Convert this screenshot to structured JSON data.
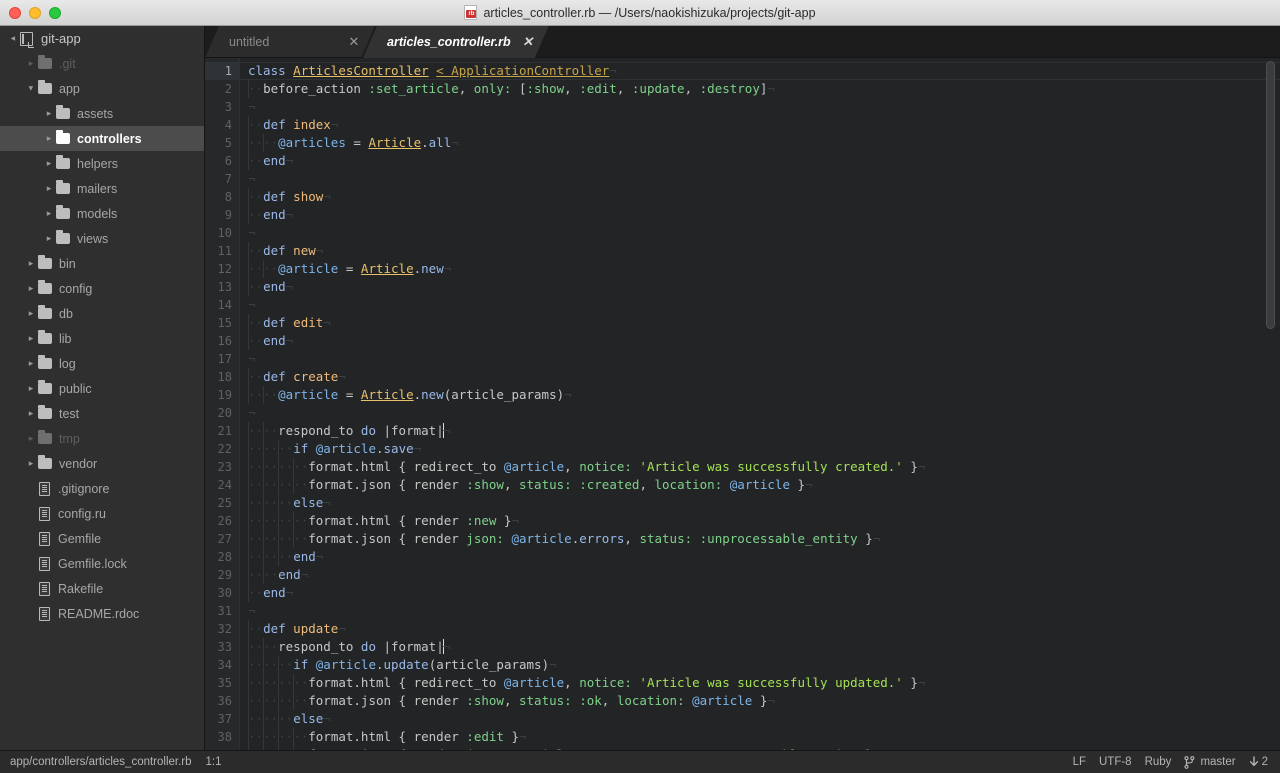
{
  "window": {
    "title": "articles_controller.rb — /Users/naokishizuka/projects/git-app",
    "file_icon": "ruby-file-icon",
    "icon_text": "rb",
    "traffic_lights": [
      "close-button",
      "minimize-button",
      "maximize-button"
    ]
  },
  "sidebar": {
    "root": {
      "label": "git-app",
      "icon": "repository-icon",
      "twisty": "▾"
    },
    "items": [
      {
        "label": ".git",
        "type": "folder",
        "depth": 1,
        "twisty": "▸",
        "dim": true,
        "selected": false
      },
      {
        "label": "app",
        "type": "folder",
        "depth": 1,
        "twisty": "▾",
        "dim": false,
        "selected": false
      },
      {
        "label": "assets",
        "type": "folder",
        "depth": 2,
        "twisty": "▸",
        "dim": false,
        "selected": false
      },
      {
        "label": "controllers",
        "type": "folder",
        "depth": 2,
        "twisty": "▸",
        "dim": false,
        "selected": true
      },
      {
        "label": "helpers",
        "type": "folder",
        "depth": 2,
        "twisty": "▸",
        "dim": false,
        "selected": false
      },
      {
        "label": "mailers",
        "type": "folder",
        "depth": 2,
        "twisty": "▸",
        "dim": false,
        "selected": false
      },
      {
        "label": "models",
        "type": "folder",
        "depth": 2,
        "twisty": "▸",
        "dim": false,
        "selected": false
      },
      {
        "label": "views",
        "type": "folder",
        "depth": 2,
        "twisty": "▸",
        "dim": false,
        "selected": false
      },
      {
        "label": "bin",
        "type": "folder",
        "depth": 1,
        "twisty": "▸",
        "dim": false,
        "selected": false
      },
      {
        "label": "config",
        "type": "folder",
        "depth": 1,
        "twisty": "▸",
        "dim": false,
        "selected": false
      },
      {
        "label": "db",
        "type": "folder",
        "depth": 1,
        "twisty": "▸",
        "dim": false,
        "selected": false
      },
      {
        "label": "lib",
        "type": "folder",
        "depth": 1,
        "twisty": "▸",
        "dim": false,
        "selected": false
      },
      {
        "label": "log",
        "type": "folder",
        "depth": 1,
        "twisty": "▸",
        "dim": false,
        "selected": false
      },
      {
        "label": "public",
        "type": "folder",
        "depth": 1,
        "twisty": "▸",
        "dim": false,
        "selected": false
      },
      {
        "label": "test",
        "type": "folder",
        "depth": 1,
        "twisty": "▸",
        "dim": false,
        "selected": false
      },
      {
        "label": "tmp",
        "type": "folder",
        "depth": 1,
        "twisty": "▸",
        "dim": true,
        "selected": false
      },
      {
        "label": "vendor",
        "type": "folder",
        "depth": 1,
        "twisty": "▸",
        "dim": false,
        "selected": false
      },
      {
        "label": ".gitignore",
        "type": "file",
        "depth": 1,
        "twisty": "",
        "dim": false,
        "selected": false
      },
      {
        "label": "config.ru",
        "type": "file",
        "depth": 1,
        "twisty": "",
        "dim": false,
        "selected": false
      },
      {
        "label": "Gemfile",
        "type": "file",
        "depth": 1,
        "twisty": "",
        "dim": false,
        "selected": false
      },
      {
        "label": "Gemfile.lock",
        "type": "file",
        "depth": 1,
        "twisty": "",
        "dim": false,
        "selected": false
      },
      {
        "label": "Rakefile",
        "type": "file",
        "depth": 1,
        "twisty": "",
        "dim": false,
        "selected": false
      },
      {
        "label": "README.rdoc",
        "type": "file",
        "depth": 1,
        "twisty": "",
        "dim": false,
        "selected": false
      }
    ]
  },
  "tabs": [
    {
      "label": "untitled",
      "active": false,
      "close_icon": "close-icon"
    },
    {
      "label": "articles_controller.rb",
      "active": true,
      "close_icon": "close-icon"
    }
  ],
  "editor": {
    "first_line": 1,
    "visible_lines": 39,
    "cursor_line": 1,
    "lines": [
      {
        "n": 1,
        "indent": 0,
        "tokens": [
          [
            "k",
            "class"
          ],
          [
            "pl",
            " "
          ],
          [
            "cls",
            "ArticlesController"
          ],
          [
            "pl",
            " "
          ],
          [
            "cls2",
            "< ApplicationController"
          ],
          [
            "inv",
            "¬"
          ]
        ]
      },
      {
        "n": 2,
        "indent": 1,
        "tokens": [
          [
            "pl",
            "before_action "
          ],
          [
            "sym",
            ":set_article"
          ],
          [
            "punc",
            ", "
          ],
          [
            "sym",
            "only:"
          ],
          [
            "punc",
            " ["
          ],
          [
            "sym",
            ":show"
          ],
          [
            "punc",
            ", "
          ],
          [
            "sym",
            ":edit"
          ],
          [
            "punc",
            ", "
          ],
          [
            "sym",
            ":update"
          ],
          [
            "punc",
            ", "
          ],
          [
            "sym",
            ":destroy"
          ],
          [
            "punc",
            "]"
          ],
          [
            "inv",
            "¬"
          ]
        ]
      },
      {
        "n": 3,
        "indent": 0,
        "tokens": [
          [
            "inv",
            "¬"
          ]
        ]
      },
      {
        "n": 4,
        "indent": 1,
        "tokens": [
          [
            "k",
            "def"
          ],
          [
            "pl",
            " "
          ],
          [
            "fn",
            "index"
          ],
          [
            "inv",
            "¬"
          ]
        ]
      },
      {
        "n": 5,
        "indent": 2,
        "tokens": [
          [
            "ivar",
            "@articles"
          ],
          [
            "pl",
            " = "
          ],
          [
            "cls",
            "Article"
          ],
          [
            "punc",
            "."
          ],
          [
            "mth",
            "all"
          ],
          [
            "inv",
            "¬"
          ]
        ]
      },
      {
        "n": 6,
        "indent": 1,
        "tokens": [
          [
            "k",
            "end"
          ],
          [
            "inv",
            "¬"
          ]
        ]
      },
      {
        "n": 7,
        "indent": 0,
        "tokens": [
          [
            "inv",
            "¬"
          ]
        ]
      },
      {
        "n": 8,
        "indent": 1,
        "tokens": [
          [
            "k",
            "def"
          ],
          [
            "pl",
            " "
          ],
          [
            "fn",
            "show"
          ],
          [
            "inv",
            "¬"
          ]
        ]
      },
      {
        "n": 9,
        "indent": 1,
        "tokens": [
          [
            "k",
            "end"
          ],
          [
            "inv",
            "¬"
          ]
        ]
      },
      {
        "n": 10,
        "indent": 0,
        "tokens": [
          [
            "inv",
            "¬"
          ]
        ]
      },
      {
        "n": 11,
        "indent": 1,
        "tokens": [
          [
            "k",
            "def"
          ],
          [
            "pl",
            " "
          ],
          [
            "fn",
            "new"
          ],
          [
            "inv",
            "¬"
          ]
        ]
      },
      {
        "n": 12,
        "indent": 2,
        "tokens": [
          [
            "ivar",
            "@article"
          ],
          [
            "pl",
            " = "
          ],
          [
            "cls",
            "Article"
          ],
          [
            "punc",
            "."
          ],
          [
            "mth",
            "new"
          ],
          [
            "inv",
            "¬"
          ]
        ]
      },
      {
        "n": 13,
        "indent": 1,
        "tokens": [
          [
            "k",
            "end"
          ],
          [
            "inv",
            "¬"
          ]
        ]
      },
      {
        "n": 14,
        "indent": 0,
        "tokens": [
          [
            "inv",
            "¬"
          ]
        ]
      },
      {
        "n": 15,
        "indent": 1,
        "tokens": [
          [
            "k",
            "def"
          ],
          [
            "pl",
            " "
          ],
          [
            "fn",
            "edit"
          ],
          [
            "inv",
            "¬"
          ]
        ]
      },
      {
        "n": 16,
        "indent": 1,
        "tokens": [
          [
            "k",
            "end"
          ],
          [
            "inv",
            "¬"
          ]
        ]
      },
      {
        "n": 17,
        "indent": 0,
        "tokens": [
          [
            "inv",
            "¬"
          ]
        ]
      },
      {
        "n": 18,
        "indent": 1,
        "tokens": [
          [
            "k",
            "def"
          ],
          [
            "pl",
            " "
          ],
          [
            "fn",
            "create"
          ],
          [
            "inv",
            "¬"
          ]
        ]
      },
      {
        "n": 19,
        "indent": 2,
        "tokens": [
          [
            "ivar",
            "@article"
          ],
          [
            "pl",
            " = "
          ],
          [
            "cls",
            "Article"
          ],
          [
            "punc",
            "."
          ],
          [
            "mth",
            "new"
          ],
          [
            "punc",
            "(article_params)"
          ],
          [
            "inv",
            "¬"
          ]
        ]
      },
      {
        "n": 20,
        "indent": 0,
        "tokens": [
          [
            "inv",
            "¬"
          ]
        ]
      },
      {
        "n": 21,
        "indent": 2,
        "tokens": [
          [
            "pl",
            "respond_to "
          ],
          [
            "k",
            "do"
          ],
          [
            "pl",
            " |format|"
          ],
          [
            "cursor",
            ""
          ],
          [
            "inv",
            "¬"
          ]
        ]
      },
      {
        "n": 22,
        "indent": 3,
        "tokens": [
          [
            "k",
            "if"
          ],
          [
            "pl",
            " "
          ],
          [
            "ivar",
            "@article"
          ],
          [
            "punc",
            "."
          ],
          [
            "mth",
            "save"
          ],
          [
            "inv",
            "¬"
          ]
        ]
      },
      {
        "n": 23,
        "indent": 4,
        "tokens": [
          [
            "pl",
            "format.html { redirect_to "
          ],
          [
            "ivar",
            "@article"
          ],
          [
            "punc",
            ", "
          ],
          [
            "sym",
            "notice:"
          ],
          [
            "pl",
            " "
          ],
          [
            "str",
            "'Article was successfully created.'"
          ],
          [
            "pl",
            " }"
          ],
          [
            "inv",
            "¬"
          ]
        ]
      },
      {
        "n": 24,
        "indent": 4,
        "tokens": [
          [
            "pl",
            "format.json { render "
          ],
          [
            "sym",
            ":show"
          ],
          [
            "punc",
            ", "
          ],
          [
            "sym",
            "status:"
          ],
          [
            "pl",
            " "
          ],
          [
            "sym",
            ":created"
          ],
          [
            "punc",
            ", "
          ],
          [
            "sym",
            "location:"
          ],
          [
            "pl",
            " "
          ],
          [
            "ivar",
            "@article"
          ],
          [
            "pl",
            " }"
          ],
          [
            "inv",
            "¬"
          ]
        ]
      },
      {
        "n": 25,
        "indent": 3,
        "tokens": [
          [
            "k",
            "else"
          ],
          [
            "inv",
            "¬"
          ]
        ]
      },
      {
        "n": 26,
        "indent": 4,
        "tokens": [
          [
            "pl",
            "format.html { render "
          ],
          [
            "sym",
            ":new"
          ],
          [
            "pl",
            " }"
          ],
          [
            "inv",
            "¬"
          ]
        ]
      },
      {
        "n": 27,
        "indent": 4,
        "tokens": [
          [
            "pl",
            "format.json { render "
          ],
          [
            "sym",
            "json:"
          ],
          [
            "pl",
            " "
          ],
          [
            "ivar",
            "@article"
          ],
          [
            "punc",
            "."
          ],
          [
            "mth",
            "errors"
          ],
          [
            "punc",
            ", "
          ],
          [
            "sym",
            "status:"
          ],
          [
            "pl",
            " "
          ],
          [
            "sym",
            ":unprocessable_entity"
          ],
          [
            "pl",
            " }"
          ],
          [
            "inv",
            "¬"
          ]
        ]
      },
      {
        "n": 28,
        "indent": 3,
        "tokens": [
          [
            "k",
            "end"
          ],
          [
            "inv",
            "¬"
          ]
        ]
      },
      {
        "n": 29,
        "indent": 2,
        "tokens": [
          [
            "k",
            "end"
          ],
          [
            "inv",
            "¬"
          ]
        ]
      },
      {
        "n": 30,
        "indent": 1,
        "tokens": [
          [
            "k",
            "end"
          ],
          [
            "inv",
            "¬"
          ]
        ]
      },
      {
        "n": 31,
        "indent": 0,
        "tokens": [
          [
            "inv",
            "¬"
          ]
        ]
      },
      {
        "n": 32,
        "indent": 1,
        "tokens": [
          [
            "k",
            "def"
          ],
          [
            "pl",
            " "
          ],
          [
            "fn",
            "update"
          ],
          [
            "inv",
            "¬"
          ]
        ]
      },
      {
        "n": 33,
        "indent": 2,
        "tokens": [
          [
            "pl",
            "respond_to "
          ],
          [
            "k",
            "do"
          ],
          [
            "pl",
            " |format|"
          ],
          [
            "cursor",
            ""
          ],
          [
            "inv",
            "¬"
          ]
        ]
      },
      {
        "n": 34,
        "indent": 3,
        "tokens": [
          [
            "k",
            "if"
          ],
          [
            "pl",
            " "
          ],
          [
            "ivar",
            "@article"
          ],
          [
            "punc",
            "."
          ],
          [
            "mth",
            "update"
          ],
          [
            "punc",
            "(article_params)"
          ],
          [
            "inv",
            "¬"
          ]
        ]
      },
      {
        "n": 35,
        "indent": 4,
        "tokens": [
          [
            "pl",
            "format.html { redirect_to "
          ],
          [
            "ivar",
            "@article"
          ],
          [
            "punc",
            ", "
          ],
          [
            "sym",
            "notice:"
          ],
          [
            "pl",
            " "
          ],
          [
            "str",
            "'Article was successfully updated.'"
          ],
          [
            "pl",
            " }"
          ],
          [
            "inv",
            "¬"
          ]
        ]
      },
      {
        "n": 36,
        "indent": 4,
        "tokens": [
          [
            "pl",
            "format.json { render "
          ],
          [
            "sym",
            ":show"
          ],
          [
            "punc",
            ", "
          ],
          [
            "sym",
            "status:"
          ],
          [
            "pl",
            " "
          ],
          [
            "sym",
            ":ok"
          ],
          [
            "punc",
            ", "
          ],
          [
            "sym",
            "location:"
          ],
          [
            "pl",
            " "
          ],
          [
            "ivar",
            "@article"
          ],
          [
            "pl",
            " }"
          ],
          [
            "inv",
            "¬"
          ]
        ]
      },
      {
        "n": 37,
        "indent": 3,
        "tokens": [
          [
            "k",
            "else"
          ],
          [
            "inv",
            "¬"
          ]
        ]
      },
      {
        "n": 38,
        "indent": 4,
        "tokens": [
          [
            "pl",
            "format.html { render "
          ],
          [
            "sym",
            ":edit"
          ],
          [
            "pl",
            " }"
          ],
          [
            "inv",
            "¬"
          ]
        ]
      },
      {
        "n": 39,
        "indent": 4,
        "tokens": [
          [
            "pl",
            "format.json { render "
          ],
          [
            "sym",
            "json:"
          ],
          [
            "pl",
            " "
          ],
          [
            "ivar",
            "@article"
          ],
          [
            "punc",
            "."
          ],
          [
            "mth",
            "errors"
          ],
          [
            "punc",
            ", "
          ],
          [
            "sym",
            "status:"
          ],
          [
            "pl",
            " "
          ],
          [
            "sym",
            ":unprocessable_entity"
          ],
          [
            "pl",
            " }"
          ],
          [
            "inv",
            "¬"
          ]
        ]
      }
    ]
  },
  "statusbar": {
    "path": "app/controllers/articles_controller.rb",
    "cursor_position": "1:1",
    "line_ending": "LF",
    "encoding": "UTF-8",
    "grammar": "Ruby",
    "branch_icon": "git-branch-icon",
    "branch": "master",
    "pull_icon": "arrow-down-icon",
    "pull_count": "2"
  }
}
